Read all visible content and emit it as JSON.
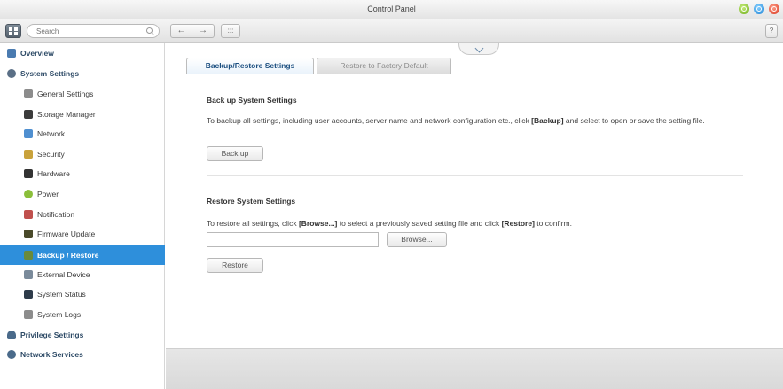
{
  "window": {
    "title": "Control Panel"
  },
  "toolbar": {
    "search_placeholder": "Search",
    "back_glyph": "←",
    "forward_glyph": "→",
    "grid_glyph": ":::",
    "help_glyph": "?"
  },
  "sidebar": {
    "items": [
      {
        "label": "Overview",
        "icon": "overview-icon",
        "color": "#4a7bb0"
      },
      {
        "label": "System Settings",
        "icon": "gear-icon",
        "color": "#5a6f86"
      },
      {
        "label": "General Settings",
        "icon": "document-icon",
        "color": "#8c8c8c"
      },
      {
        "label": "Storage Manager",
        "icon": "storage-icon",
        "color": "#3b3b3b"
      },
      {
        "label": "Network",
        "icon": "network-icon",
        "color": "#4f8fd0"
      },
      {
        "label": "Security",
        "icon": "lock-icon",
        "color": "#c9a23b"
      },
      {
        "label": "Hardware",
        "icon": "hardware-icon",
        "color": "#333333"
      },
      {
        "label": "Power",
        "icon": "power-icon",
        "color": "#8bbf3a"
      },
      {
        "label": "Notification",
        "icon": "notification-icon",
        "color": "#c0504d"
      },
      {
        "label": "Firmware Update",
        "icon": "firmware-icon",
        "color": "#4a4a2a"
      },
      {
        "label": "Backup / Restore",
        "icon": "backup-icon",
        "color": "#6a8a3a"
      },
      {
        "label": "External Device",
        "icon": "external-device-icon",
        "color": "#7a8a9a"
      },
      {
        "label": "System Status",
        "icon": "monitor-icon",
        "color": "#2e3b4a"
      },
      {
        "label": "System Logs",
        "icon": "logs-icon",
        "color": "#8c8c8c"
      },
      {
        "label": "Privilege Settings",
        "icon": "user-icon",
        "color": "#4a6a8a"
      },
      {
        "label": "Network Services",
        "icon": "globe-icon",
        "color": "#4a6a8a"
      }
    ]
  },
  "main": {
    "tabs": [
      {
        "label": "Backup/Restore Settings"
      },
      {
        "label": "Restore to Factory Default"
      }
    ],
    "backup": {
      "title": "Back up System Settings",
      "desc_before": "To backup all settings, including user accounts, server name and network configuration etc., click ",
      "desc_bold": "[Backup]",
      "desc_after": " and select to open or save the setting file.",
      "button": "Back up"
    },
    "restore": {
      "title": "Restore System Settings",
      "desc_part1": "To restore all settings, click ",
      "desc_bold1": "[Browse...]",
      "desc_part2": " to select a previously saved setting file and click ",
      "desc_bold2": "[Restore]",
      "desc_part3": " to confirm.",
      "browse_button": "Browse...",
      "file_value": "",
      "restore_button": "Restore"
    }
  }
}
